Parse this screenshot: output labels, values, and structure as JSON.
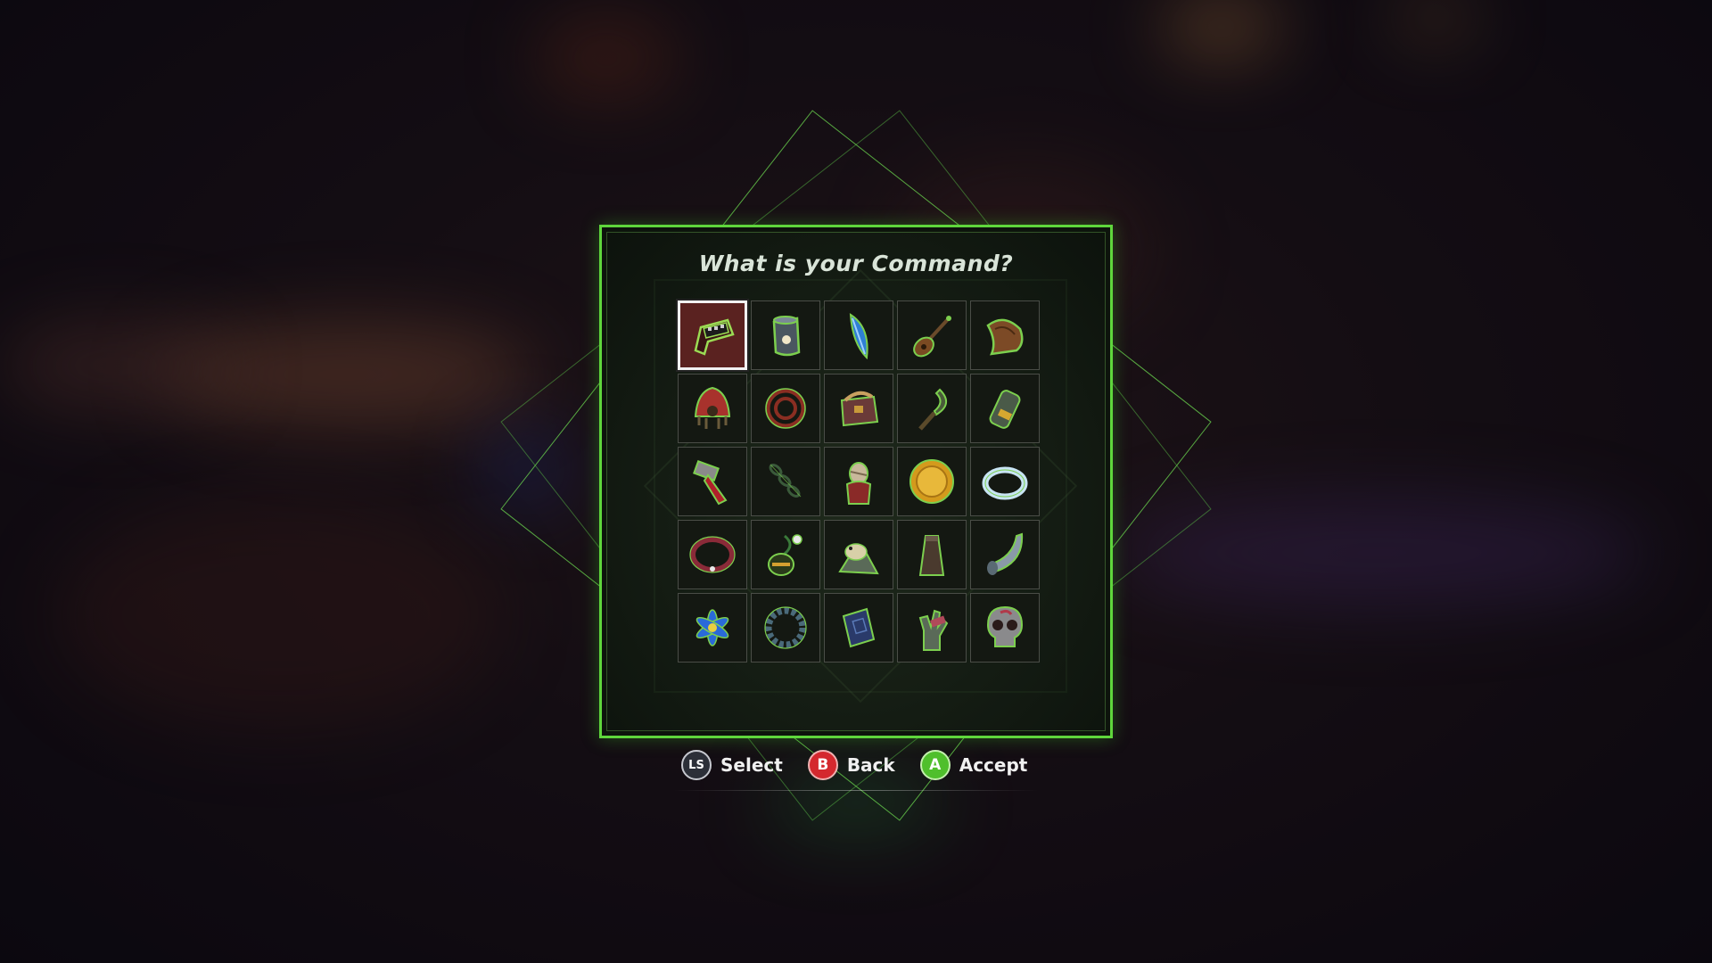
{
  "dialog": {
    "title": "What is your Command?",
    "selected_index": 0
  },
  "items": [
    {
      "icon": "circuit-board-icon"
    },
    {
      "icon": "jar-icon"
    },
    {
      "icon": "blue-feather-icon"
    },
    {
      "icon": "guitar-icon"
    },
    {
      "icon": "bread-loaf-icon"
    },
    {
      "icon": "headdress-icon"
    },
    {
      "icon": "coiled-whip-icon"
    },
    {
      "icon": "satchel-icon"
    },
    {
      "icon": "sickle-icon"
    },
    {
      "icon": "capsule-icon"
    },
    {
      "icon": "red-hammer-icon"
    },
    {
      "icon": "chain-icon"
    },
    {
      "icon": "mummy-icon"
    },
    {
      "icon": "gold-coin-icon"
    },
    {
      "icon": "silver-ring-icon"
    },
    {
      "icon": "red-bracelet-icon"
    },
    {
      "icon": "lantern-plant-icon"
    },
    {
      "icon": "bird-figurine-icon"
    },
    {
      "icon": "sack-icon"
    },
    {
      "icon": "horn-icon"
    },
    {
      "icon": "blue-flower-icon"
    },
    {
      "icon": "wreath-icon"
    },
    {
      "icon": "book-icon"
    },
    {
      "icon": "hand-statue-icon"
    },
    {
      "icon": "skull-icon"
    }
  ],
  "hints": {
    "select": {
      "button": "LS",
      "label": "Select"
    },
    "back": {
      "button": "B",
      "label": "Back"
    },
    "accept": {
      "button": "A",
      "label": "Accept"
    }
  },
  "colors": {
    "frame": "#5fd63c",
    "selected_cell": "#5a2220",
    "b_button": "#d4282e",
    "a_button": "#4fbf2c"
  }
}
